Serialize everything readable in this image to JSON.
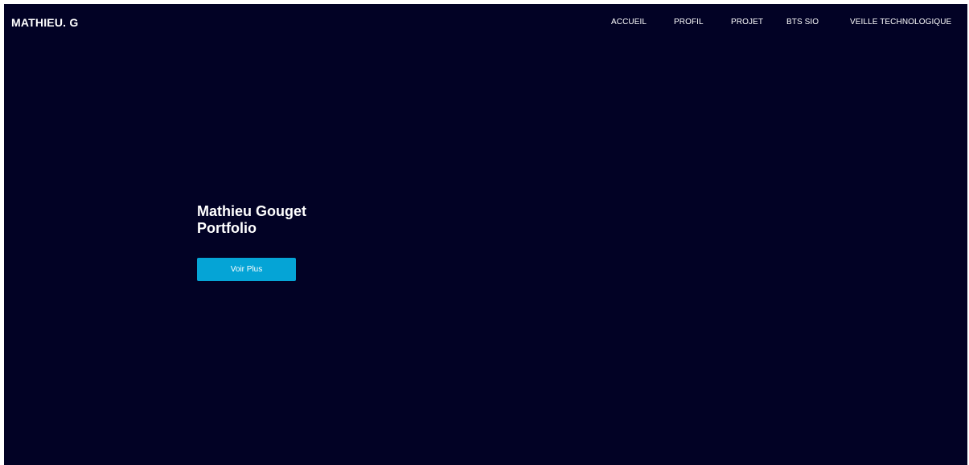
{
  "navbar": {
    "brand": "MATHIEU. G",
    "links": [
      {
        "label": "ACCUEIL"
      },
      {
        "label": "PROFIL"
      },
      {
        "label": "PROJET"
      },
      {
        "label": "BTS SIO"
      },
      {
        "label": "VEILLE TECHNOLOGIQUE"
      }
    ]
  },
  "hero": {
    "title_line1": "Mathieu Gouget",
    "title_line2": "Portfolio",
    "button_label": "Voir Plus"
  },
  "colors": {
    "background": "#020225",
    "accent": "#05a4d6",
    "text": "#ffffff"
  }
}
